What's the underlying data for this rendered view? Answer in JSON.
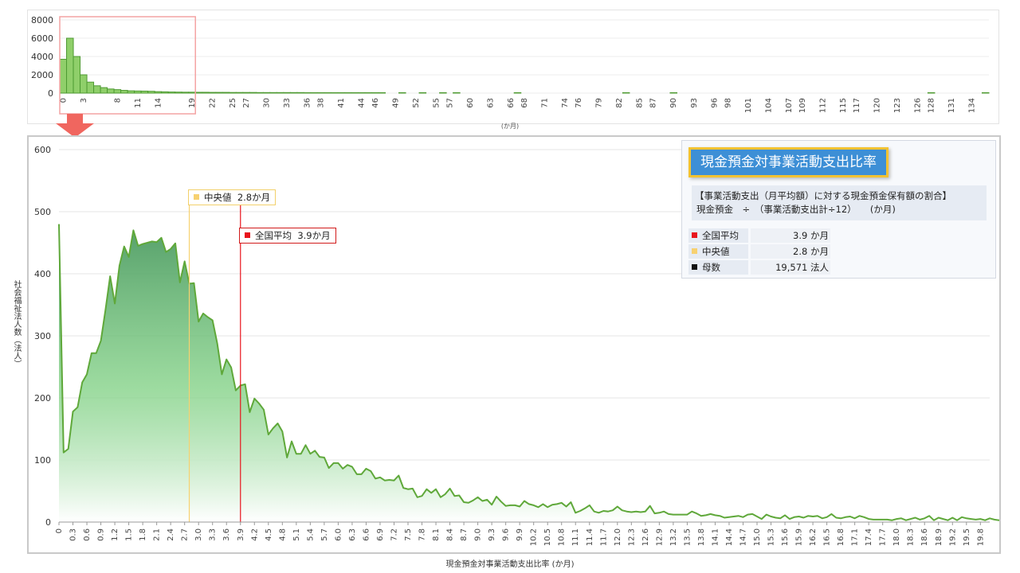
{
  "info": {
    "title": "現金預金対事業活動支出比率",
    "desc_line1": "【事業活動支出（月平均額）に対する現金預金保有額の割合】",
    "desc_line2": "現金預金　÷　（事業活動支出計÷12）　　(か月)",
    "rows": [
      {
        "label": "全国平均",
        "value": "3.9 か月",
        "color": "#e8141c"
      },
      {
        "label": "中央値",
        "value": "2.8 か月",
        "color": "#f7d170"
      },
      {
        "label": "母数",
        "value": "19,571  法人",
        "color": "#111111"
      }
    ]
  },
  "annotations": {
    "median": {
      "label": "中央値",
      "value": "2.8か月",
      "color": "#f7d170"
    },
    "mean": {
      "label": "全国平均",
      "value": "3.9か月",
      "color": "#e8141c"
    }
  },
  "labels": {
    "y_main": "社会福祉法人数（法人）",
    "x_main": "現金預金対事業活動支出比率 (か月)",
    "x_top": "(か月)"
  },
  "chart_data": [
    {
      "type": "bar",
      "series": "overview histogram",
      "x_start": 0,
      "x_end": 137,
      "values": [
        3700,
        6000,
        4000,
        2000,
        1200,
        800,
        600,
        450,
        380,
        300,
        250,
        230,
        220,
        200,
        160,
        140,
        120,
        110,
        100,
        100,
        90,
        90,
        80,
        80,
        80,
        70,
        70,
        70,
        70,
        60,
        60,
        60,
        60,
        60,
        60,
        60,
        50,
        50,
        50,
        50,
        50,
        50,
        50,
        50,
        50,
        50,
        50,
        50,
        0,
        0,
        50,
        0,
        0,
        50,
        0,
        0,
        50,
        0,
        50,
        0,
        0,
        0,
        0,
        0,
        0,
        0,
        0,
        50,
        0,
        0,
        0,
        0,
        0,
        0,
        0,
        0,
        0,
        0,
        0,
        0,
        0,
        0,
        0,
        50,
        0,
        0,
        0,
        0,
        0,
        0,
        50,
        0,
        0,
        0,
        0,
        0,
        0,
        0,
        0,
        0,
        0,
        0,
        0,
        0,
        0,
        0,
        0,
        0,
        0,
        0,
        0,
        0,
        0,
        0,
        0,
        0,
        0,
        0,
        0,
        0,
        0,
        0,
        0,
        0,
        0,
        0,
        0,
        0,
        50,
        0,
        0,
        0,
        0,
        0,
        0,
        0,
        50
      ],
      "x_tick_labels": [
        "0",
        "3",
        "8",
        "11",
        "14",
        "19",
        "22",
        "25",
        "27",
        "30",
        "33",
        "36",
        "38",
        "41",
        "44",
        "46",
        "49",
        "52",
        "55",
        "57",
        "60",
        "63",
        "66",
        "68",
        "71",
        "74",
        "76",
        "79",
        "82",
        "85",
        "87",
        "90",
        "93",
        "96",
        "98",
        "101",
        "104",
        "107",
        "109",
        "112",
        "115",
        "117",
        "120",
        "123",
        "126",
        "128",
        "131",
        "134"
      ],
      "y_ticks": [
        0,
        2000,
        4000,
        6000,
        8000
      ],
      "ylim": [
        0,
        8000
      ],
      "zoom_range": [
        0,
        20
      ]
    },
    {
      "type": "area",
      "x_start": 0,
      "x_step": 0.1,
      "values": [
        480,
        112,
        118,
        178,
        185,
        225,
        238,
        272,
        272,
        292,
        342,
        396,
        352,
        413,
        444,
        427,
        470,
        445,
        448,
        450,
        452,
        451,
        458,
        435,
        440,
        449,
        386,
        420,
        384,
        385,
        323,
        336,
        330,
        325,
        288,
        238,
        262,
        249,
        212,
        220,
        222,
        177,
        199,
        191,
        181,
        141,
        151,
        159,
        146,
        104,
        130,
        110,
        110,
        124,
        110,
        115,
        105,
        104,
        87,
        95,
        95,
        86,
        92,
        89,
        77,
        77,
        86,
        82,
        70,
        72,
        67,
        68,
        67,
        75,
        55,
        53,
        54,
        40,
        42,
        53,
        47,
        53,
        40,
        45,
        54,
        42,
        43,
        32,
        31,
        35,
        40,
        34,
        36,
        28,
        41,
        33,
        26,
        27,
        27,
        25,
        34,
        29,
        27,
        24,
        29,
        24,
        28,
        29,
        31,
        25,
        32,
        15,
        18,
        22,
        27,
        17,
        15,
        18,
        17,
        19,
        25,
        19,
        17,
        16,
        17,
        16,
        17,
        26,
        14,
        15,
        17,
        13,
        12,
        12,
        12,
        12,
        17,
        14,
        10,
        11,
        13,
        11,
        10,
        7,
        8,
        9,
        10,
        8,
        12,
        13,
        9,
        5,
        12,
        9,
        7,
        6,
        11,
        5,
        8,
        9,
        7,
        10,
        9,
        10,
        6,
        8,
        13,
        7,
        6,
        8,
        9,
        6,
        10,
        8,
        5,
        4,
        4,
        4,
        4,
        3,
        5,
        6,
        3,
        5,
        7,
        4,
        6,
        10,
        3,
        7,
        5,
        3,
        7,
        3,
        8,
        6,
        5,
        4,
        5,
        3,
        6,
        4,
        3,
        5,
        6,
        3,
        4,
        6,
        4
      ],
      "x_tick_labels": [
        "0",
        "0.3",
        "0.6",
        "0.9",
        "1.2",
        "1.5",
        "1.8",
        "2.1",
        "2.4",
        "2.7",
        "3.0",
        "3.3",
        "3.6",
        "3.9",
        "4.2",
        "4.5",
        "4.8",
        "5.1",
        "5.4",
        "5.7",
        "6.0",
        "6.3",
        "6.6",
        "6.9",
        "7.2",
        "7.5",
        "7.8",
        "8.1",
        "8.4",
        "8.7",
        "9.0",
        "9.3",
        "9.6",
        "9.9",
        "10.2",
        "10.5",
        "10.8",
        "11.1",
        "11.4",
        "11.7",
        "12.0",
        "12.3",
        "12.6",
        "12.9",
        "13.2",
        "13.5",
        "13.8",
        "14.1",
        "14.4",
        "14.7",
        "15.0",
        "15.3",
        "15.6",
        "15.9",
        "16.2",
        "16.5",
        "16.8",
        "17.1",
        "17.4",
        "17.7",
        "18.0",
        "18.3",
        "18.6",
        "18.9",
        "19.2",
        "19.5",
        "19.8"
      ],
      "y_ticks": [
        0,
        100,
        200,
        300,
        400,
        500,
        600
      ],
      "ylim": [
        0,
        600
      ],
      "xlim": [
        0,
        20
      ],
      "vlines": [
        {
          "x": 2.8,
          "name": "中央値",
          "color": "#f7d170"
        },
        {
          "x": 3.9,
          "name": "全国平均",
          "color": "#e8141c"
        }
      ]
    }
  ],
  "colors": {
    "line": "#5fa83a",
    "fill_top": "#4c9a62",
    "fill_bottom": "#ffffff",
    "bar_fill": "#8fcf6a",
    "bar_stroke": "#4e9a32",
    "zoom_box": "#f4a3a3"
  }
}
